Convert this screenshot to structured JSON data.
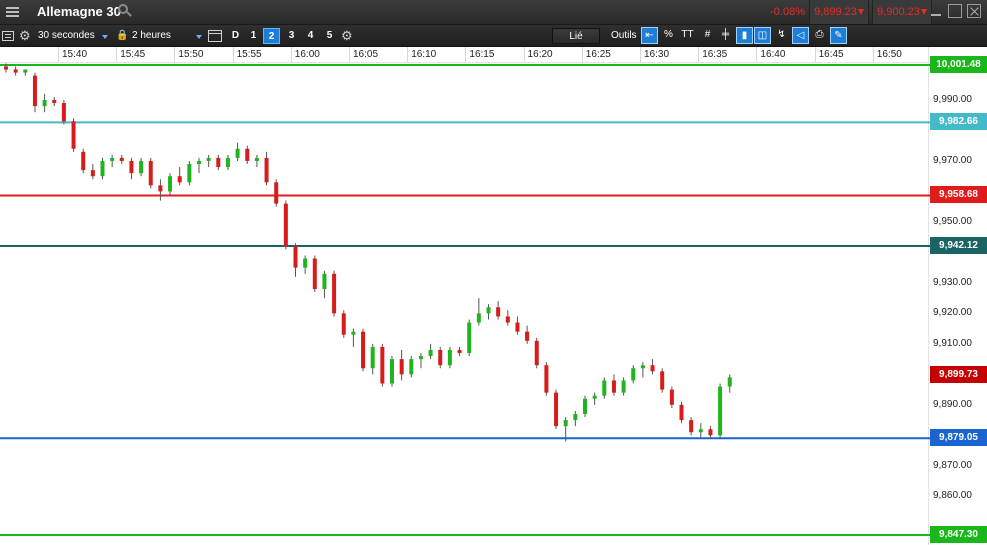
{
  "window": {
    "title": "Allemagne 30",
    "change": "-0.08%",
    "sell_price": "9,899.23",
    "buy_price": "9,900.23"
  },
  "toolbar": {
    "interval": "30 secondes",
    "range": "2 heures",
    "period_d": "D",
    "pages": [
      "1",
      "2",
      "3",
      "4",
      "5"
    ],
    "active_page": "2",
    "linked": "Lié",
    "tools": "Outils",
    "percent": "%",
    "text_tool": "TT"
  },
  "time_ticks": [
    "15:40",
    "15:45",
    "15:50",
    "15:55",
    "16:00",
    "16:05",
    "16:10",
    "16:15",
    "16:20",
    "16:25",
    "16:30",
    "16:35",
    "16:40",
    "16:45",
    "16:50"
  ],
  "price_ticks": [
    "9,990.00",
    "9,970.00",
    "9,950.00",
    "9,930.00",
    "9,920.00",
    "9,910.00",
    "9,890.00",
    "9,870.00",
    "9,860.00"
  ],
  "lines": [
    {
      "label": "10,001.48",
      "value": 10001.48,
      "color": "#19b719"
    },
    {
      "label": "9,982.66",
      "value": 9982.66,
      "color": "#44b9c8"
    },
    {
      "label": "9,958.68",
      "value": 9958.68,
      "color": "#e01b1b"
    },
    {
      "label": "9,942.12",
      "value": 9942.12,
      "color": "#1b6464"
    },
    {
      "label": "9,899.73",
      "value": 9899.73,
      "color": "#c40000"
    },
    {
      "label": "9,879.05",
      "value": 9879.05,
      "color": "#1a64d2"
    },
    {
      "label": "9,847.30",
      "value": 9847.3,
      "color": "#19b719"
    }
  ],
  "colors": {
    "up": "#1fb51f",
    "down": "#d81b1b",
    "accent": "#1d7ed6",
    "titlebar": "#2e2e2e"
  },
  "chart_data": {
    "type": "candlestick",
    "ylim": [
      9846,
      10004
    ],
    "candles": [
      [
        10001,
        10002,
        9999,
        10000
      ],
      [
        10000,
        10001,
        9998,
        9999
      ],
      [
        9999,
        10000,
        9998,
        10000
      ],
      [
        9998,
        9999,
        9986,
        9988
      ],
      [
        9988,
        9992,
        9986,
        9990
      ],
      [
        9990,
        9991,
        9988,
        9989
      ],
      [
        9989,
        9990,
        9982,
        9983
      ],
      [
        9983,
        9984,
        9973,
        9974
      ],
      [
        9973,
        9974,
        9966,
        9967
      ],
      [
        9967,
        9969,
        9964,
        9965
      ],
      [
        9965,
        9971,
        9964,
        9970
      ],
      [
        9970,
        9972,
        9968,
        9971
      ],
      [
        9971,
        9972,
        9969,
        9970
      ],
      [
        9970,
        9971,
        9964,
        9966
      ],
      [
        9966,
        9971,
        9965,
        9970
      ],
      [
        9970,
        9971,
        9961,
        9962
      ],
      [
        9962,
        9964,
        9957,
        9960
      ],
      [
        9960,
        9966,
        9959,
        9965
      ],
      [
        9965,
        9968,
        9962,
        9963
      ],
      [
        9963,
        9970,
        9962,
        9969
      ],
      [
        9969,
        9971,
        9966,
        9970
      ],
      [
        9970,
        9972,
        9968,
        9971
      ],
      [
        9971,
        9972,
        9967,
        9968
      ],
      [
        9968,
        9972,
        9967,
        9971
      ],
      [
        9971,
        9976,
        9970,
        9974
      ],
      [
        9974,
        9975,
        9969,
        9970
      ],
      [
        9970,
        9972,
        9968,
        9971
      ],
      [
        9971,
        9973,
        9962,
        9963
      ],
      [
        9963,
        9964,
        9955,
        9956
      ],
      [
        9956,
        9957,
        9941,
        9942
      ],
      [
        9942,
        9943,
        9932,
        9935
      ],
      [
        9935,
        9939,
        9933,
        9938
      ],
      [
        9938,
        9939,
        9927,
        9928
      ],
      [
        9928,
        9934,
        9925,
        9933
      ],
      [
        9933,
        9934,
        9919,
        9920
      ],
      [
        9920,
        9921,
        9912,
        9913
      ],
      [
        9913,
        9915,
        9909,
        9914
      ],
      [
        9914,
        9915,
        9901,
        9902
      ],
      [
        9902,
        9910,
        9900,
        9909
      ],
      [
        9909,
        9910,
        9896,
        9897
      ],
      [
        9897,
        9906,
        9896,
        9905
      ],
      [
        9905,
        9908,
        9898,
        9900
      ],
      [
        9900,
        9906,
        9899,
        9905
      ],
      [
        9905,
        9907,
        9902,
        9906
      ],
      [
        9906,
        9910,
        9905,
        9908
      ],
      [
        9908,
        9909,
        9902,
        9903
      ],
      [
        9903,
        9909,
        9902,
        9908
      ],
      [
        9908,
        9909,
        9906,
        9907
      ],
      [
        9907,
        9918,
        9906,
        9917
      ],
      [
        9917,
        9925,
        9916,
        9920
      ],
      [
        9920,
        9923,
        9918,
        9922
      ],
      [
        9922,
        9924,
        9918,
        9919
      ],
      [
        9919,
        9921,
        9916,
        9917
      ],
      [
        9917,
        9919,
        9913,
        9914
      ],
      [
        9914,
        9916,
        9910,
        9911
      ],
      [
        9911,
        9912,
        9902,
        9903
      ],
      [
        9903,
        9904,
        9893,
        9894
      ],
      [
        9894,
        9895,
        9882,
        9883
      ],
      [
        9883,
        9886,
        9878,
        9885
      ],
      [
        9885,
        9888,
        9883,
        9887
      ],
      [
        9887,
        9893,
        9886,
        9892
      ],
      [
        9892,
        9894,
        9890,
        9893
      ],
      [
        9893,
        9899,
        9892,
        9898
      ],
      [
        9898,
        9900,
        9893,
        9894
      ],
      [
        9894,
        9899,
        9893,
        9898
      ],
      [
        9898,
        9903,
        9897,
        9902
      ],
      [
        9902,
        9904,
        9899,
        9903
      ],
      [
        9903,
        9905,
        9900,
        9901
      ],
      [
        9901,
        9902,
        9894,
        9895
      ],
      [
        9895,
        9896,
        9889,
        9890
      ],
      [
        9890,
        9891,
        9884,
        9885
      ],
      [
        9885,
        9886,
        9880,
        9881
      ],
      [
        9881,
        9884,
        9879,
        9882
      ],
      [
        9882,
        9883,
        9879,
        9880
      ],
      [
        9880,
        9897,
        9879,
        9896
      ],
      [
        9896,
        9900,
        9894,
        9899
      ]
    ]
  }
}
